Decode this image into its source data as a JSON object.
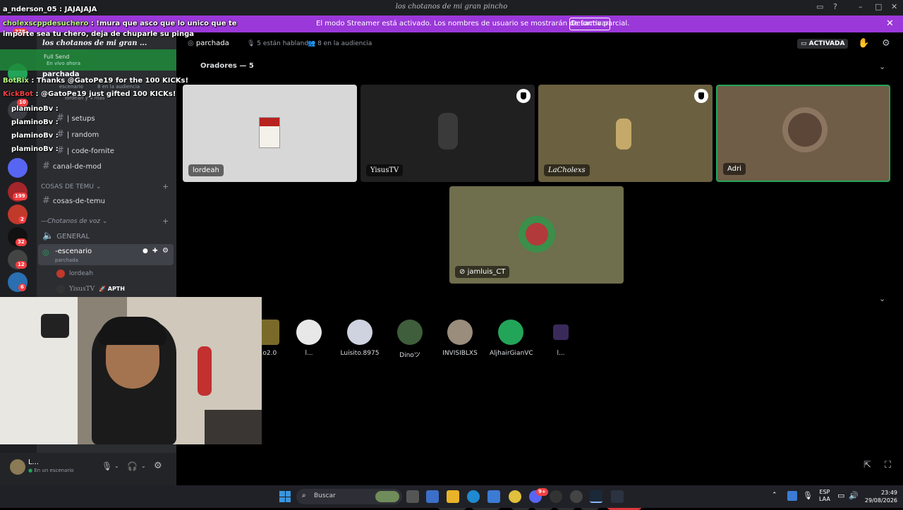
{
  "window": {
    "title": "los chotanos de mi gran pincho",
    "controls": [
      "inbox-icon",
      "help-icon",
      "minimize-icon",
      "maximize-icon",
      "close-icon"
    ]
  },
  "banner": {
    "message": "El modo Streamer está activado. Los nombres de usuario se mostrarán de forma parcial.",
    "button": "Desactivar",
    "color": "#9b38d9"
  },
  "server_rail": {
    "badges": [
      "278",
      "10",
      "199",
      "2",
      "32",
      "12",
      "6"
    ]
  },
  "sidebar": {
    "server_name": "los chotanos de mi gran ...",
    "stage_activity": {
      "app": "Full Send",
      "app_status": "En vivo ahora",
      "kicks": "100",
      "stage_name": "parchada",
      "stage_sub": "escenario",
      "stage_audience": "8 en la audiencia",
      "stage_people": "lordeah y 4 más"
    },
    "channels": [
      {
        "name": "| setups"
      },
      {
        "name": "| random"
      },
      {
        "name": "| code-fornite"
      },
      {
        "name": "canal-de-mod"
      }
    ],
    "category_temu": "COSAS DE TEMU",
    "temu_channel": "cosas-de-temu",
    "category_voice": "—Chotanos de voz",
    "voice_general": "GENERAL",
    "stage_channel": "-escenario",
    "stage_topic": "parchada",
    "stage_members": [
      {
        "name": "lordeah",
        "tag": ""
      },
      {
        "name": "YisusTV",
        "tag": "APTH"
      }
    ]
  },
  "userbar": {
    "name": "L...",
    "status": "En un escenario"
  },
  "stage": {
    "topic": "parchada",
    "speaking": "5 están hablando",
    "audience": "8 en la audiencia",
    "status": "ACTIVADA",
    "speakers_header": "Oradores — 5",
    "speakers": [
      {
        "name": "lordeah",
        "bg": "#d7d7d7",
        "moderator": false
      },
      {
        "name": "YisusTV",
        "bg": "#202020",
        "moderator": true
      },
      {
        "name": "LaCholexs",
        "bg": "#6b6140",
        "moderator": true
      },
      {
        "name": "Adri",
        "bg": "#6f5d47",
        "moderator": false
      },
      {
        "name": "jamluis_CT",
        "bg": "#6f6e4d",
        "moderator": false
      }
    ],
    "audience_members": [
      {
        "name": "...o2.0",
        "color": "#7a6a2a"
      },
      {
        "name": "l...",
        "color": "#e8e8e8"
      },
      {
        "name": "Luisito.8975",
        "color": "#cfd3df"
      },
      {
        "name": "Dinoツ",
        "color": "#3f5e3b"
      },
      {
        "name": "INVISIBLXS",
        "color": "#9a8d7c"
      },
      {
        "name": "AljhairGianVC",
        "color": "#23a559"
      },
      {
        "name": "l...",
        "color": "#3a2a5a"
      }
    ]
  },
  "chat_overlay": [
    {
      "user": "a_nderson_05",
      "text": ": JAJAJAJA"
    },
    {
      "user": "cholexscppdesuchero",
      "text": ": !mura que asco que lo unico que te"
    },
    {
      "user": "",
      "text": "importe sea tu chero, deja de chuparle su pinga"
    },
    {
      "user": "BotRix",
      "text": ": Thanks @GatoPe19 for the 100 KICKs!"
    },
    {
      "user": "KickBot",
      "text": ": @GatoPe19 just gifted 100 KICKs!"
    },
    {
      "user": "plaminoBv",
      "text": ":"
    },
    {
      "user": "plaminoBv",
      "text": ":"
    },
    {
      "user": "plaminoBv",
      "text": ":"
    },
    {
      "user": "plaminoBv",
      "text": ":"
    }
  ],
  "taskbar": {
    "search": "Buscar",
    "lang_top": "ESP",
    "lang_bottom": "LAA",
    "time": "23:49",
    "date": "29/08/2026",
    "discord_badge": "9+"
  }
}
